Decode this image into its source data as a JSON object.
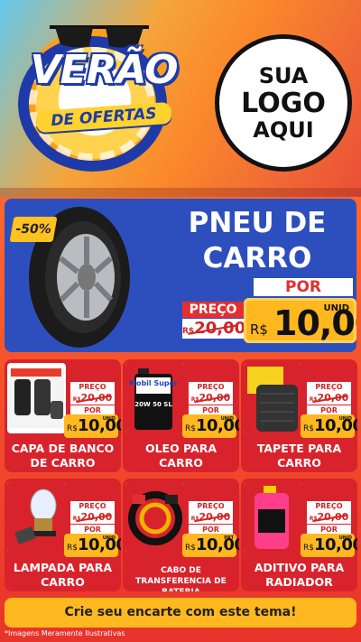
{
  "header": {
    "title_main": "VERÃO",
    "title_sub": "DE OFERTAS",
    "logo_placeholder": [
      "SUA",
      "LOGO",
      "AQUI"
    ]
  },
  "featured": {
    "discount": "-50%",
    "name_line1": "PNEU DE",
    "name_line2": "CARRO",
    "label_por": "POR",
    "label_preco": "PREÇO",
    "old_currency": "R$",
    "old_price": "20,00",
    "currency": "R$",
    "price": "10,00",
    "unit": "UNID"
  },
  "products": [
    {
      "name": "CAPA DE BANCO DE CARRO",
      "old_currency": "R$",
      "old_price": "20,00",
      "currency": "R$",
      "price": "10,00",
      "unit": "UNID",
      "label_preco": "PREÇO",
      "label_por": "POR"
    },
    {
      "name": "OLEO PARA CARRO",
      "old_currency": "R$",
      "old_price": "20,00",
      "currency": "R$",
      "price": "10,00",
      "unit": "UNID",
      "label_preco": "PREÇO",
      "label_por": "POR",
      "oil_brand": "Mobil Super",
      "oil_spec": "20W 50 SL"
    },
    {
      "name": "TAPETE PARA CARRO",
      "old_currency": "R$",
      "old_price": "20,00",
      "currency": "R$",
      "price": "10,00",
      "unit": "UNID",
      "label_preco": "PREÇO",
      "label_por": "POR"
    },
    {
      "name": "LAMPADA PARA CARRO",
      "old_currency": "R$",
      "old_price": "20,00",
      "currency": "R$",
      "price": "10,00",
      "unit": "UNID",
      "label_preco": "PREÇO",
      "label_por": "POR"
    },
    {
      "name": "CABO DE TRANSFERENCIA DE BATERIA",
      "old_currency": "R$",
      "old_price": "20,00",
      "currency": "R$",
      "price": "10,00",
      "unit": "PRT",
      "label_preco": "PREÇO",
      "label_por": "POR"
    },
    {
      "name": "ADITIVO PARA RADIADOR",
      "old_currency": "R$",
      "old_price": "20,00",
      "currency": "R$",
      "price": "10,00",
      "unit": "UNID",
      "label_preco": "PREÇO",
      "label_por": "POR"
    }
  ],
  "cta": "Crie seu encarte com este tema!",
  "disclaimer": "*Imagens Meramente Ilustrativas",
  "colors": {
    "primary_red": "#d9232c",
    "accent_yellow": "#ffb81f",
    "blue": "#2d4fbd"
  }
}
